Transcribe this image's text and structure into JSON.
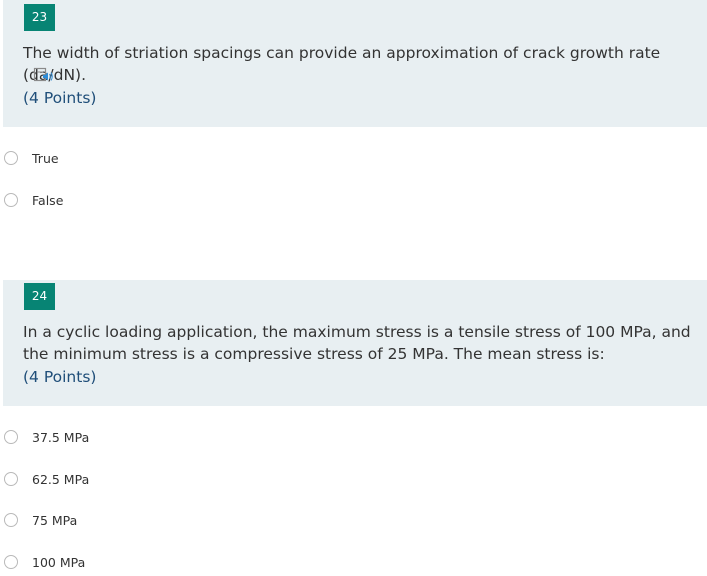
{
  "questions": [
    {
      "number": "23",
      "text": "The width of striation spacings can provide an approximation of crack growth rate (da/dN).",
      "points": "(4 Points)",
      "has_read_aloud_icon": true,
      "options": [
        {
          "label": "True"
        },
        {
          "label": "False"
        }
      ]
    },
    {
      "number": "24",
      "text": "In a cyclic loading application, the maximum stress is a tensile stress of 100 MPa, and the minimum stress is a compressive stress of 25 MPa.  The mean stress is:",
      "points": "(4 Points)",
      "options": [
        {
          "label": "37.5 MPa"
        },
        {
          "label": "62.5 MPa"
        },
        {
          "label": "75 MPa"
        },
        {
          "label": "100 MPa"
        }
      ]
    }
  ],
  "colors": {
    "question_bg": "#e8eff2",
    "number_badge": "#078474",
    "points_text": "#1f4e79",
    "radio_border": "#b9b9b9"
  }
}
